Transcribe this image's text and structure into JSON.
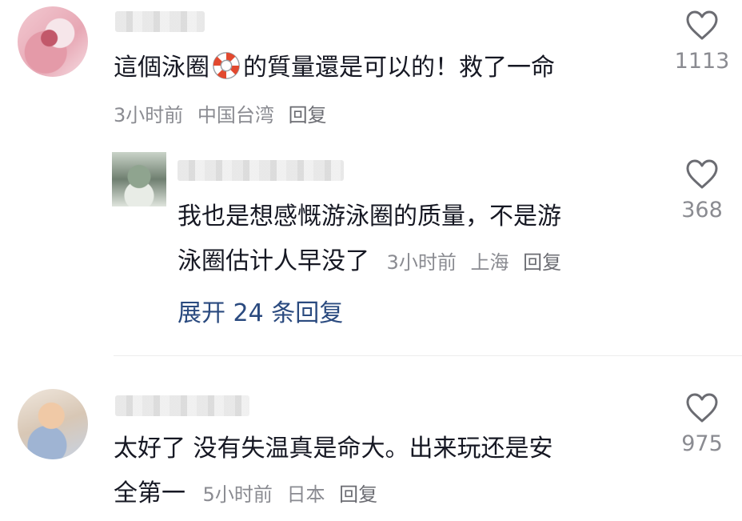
{
  "comments": [
    {
      "text": "這個泳圈",
      "text_after_icon": "的質量還是可以的！救了一命",
      "inline_icon": "lifebuoy-icon",
      "time": "3小时前",
      "location": "中国台湾",
      "reply_label": "回复",
      "likes": "1113",
      "replies": [
        {
          "line1": "我也是想感慨游泳圈的质量，不是游",
          "line2": "泳圈估计人早没了",
          "time": "3小时前",
          "location": "上海",
          "reply_label": "回复",
          "likes": "368"
        }
      ],
      "expand_label": "展开 24 条回复"
    },
    {
      "line1": "太好了 没有失温真是命大。出来玩还是安",
      "line2": "全第一",
      "time": "5小时前",
      "location": "日本",
      "reply_label": "回复",
      "likes": "975"
    }
  ],
  "icons": {
    "like": "heart-outline-icon",
    "inline": "lifebuoy-icon"
  },
  "colors": {
    "text": "#161823",
    "meta": "#8a8b91",
    "link": "#2a4a7f",
    "icon": "#6b6c72"
  }
}
